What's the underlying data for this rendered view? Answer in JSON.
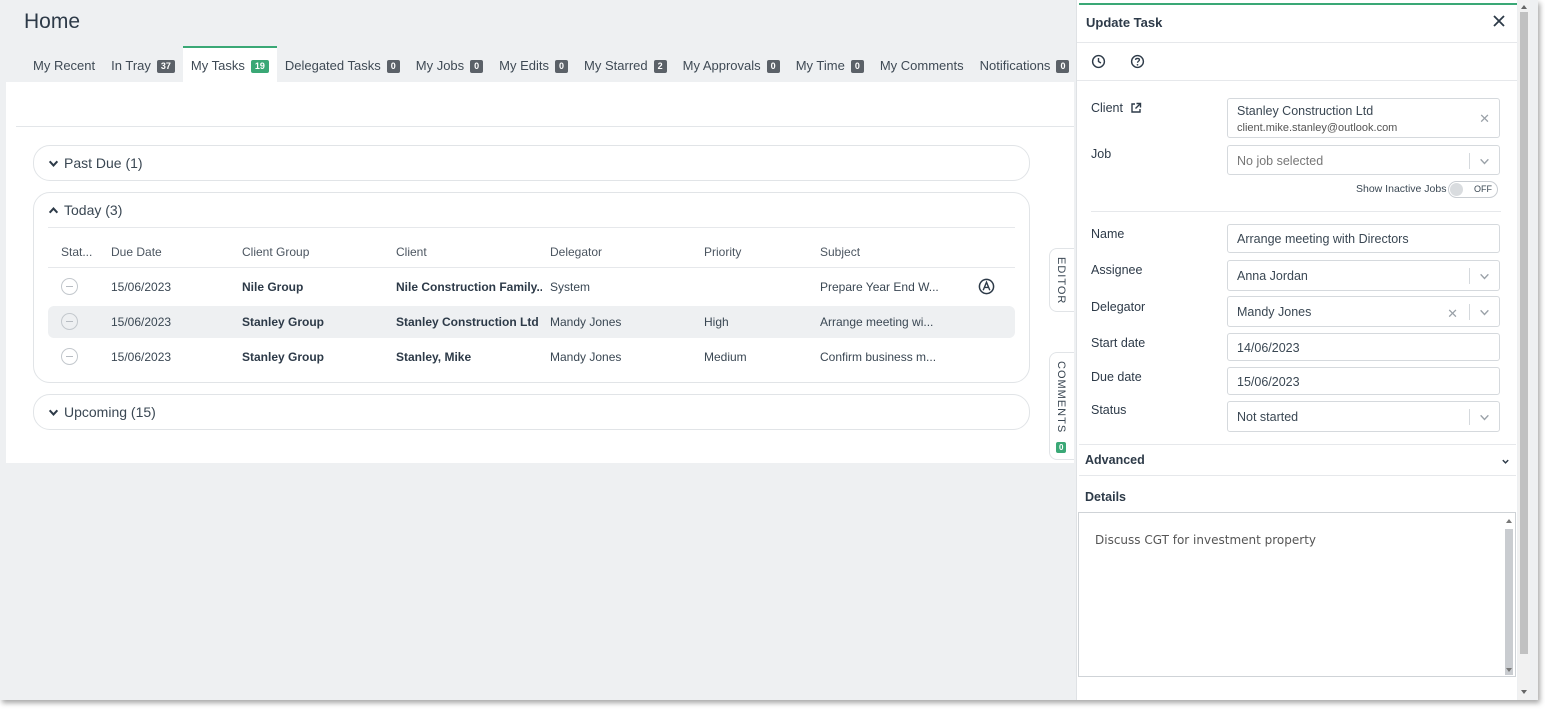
{
  "page": {
    "title": "Home"
  },
  "tabs": [
    {
      "label": "My Recent",
      "count": null
    },
    {
      "label": "In Tray",
      "count": "37"
    },
    {
      "label": "My Tasks",
      "count": "19",
      "active": true
    },
    {
      "label": "Delegated Tasks",
      "count": "0"
    },
    {
      "label": "My Jobs",
      "count": "0"
    },
    {
      "label": "My Edits",
      "count": "0"
    },
    {
      "label": "My Starred",
      "count": "2"
    },
    {
      "label": "My Approvals",
      "count": "0"
    },
    {
      "label": "My Time",
      "count": "0"
    },
    {
      "label": "My Comments",
      "count": null
    },
    {
      "label": "Notifications",
      "count": "0"
    }
  ],
  "sections": {
    "past_due": "Past Due (1)",
    "today": "Today (3)",
    "upcoming": "Upcoming (15)"
  },
  "table": {
    "headers": {
      "status": "Stat...",
      "due_date": "Due Date",
      "client_group": "Client Group",
      "client": "Client",
      "delegator": "Delegator",
      "priority": "Priority",
      "subject": "Subject"
    },
    "rows": [
      {
        "due_date": "15/06/2023",
        "client_group": "Nile Group",
        "client": "Nile Construction Family...",
        "delegator": "System",
        "priority": "",
        "subject": "Prepare Year End W..."
      },
      {
        "due_date": "15/06/2023",
        "client_group": "Stanley Group",
        "client": "Stanley Construction Ltd",
        "delegator": "Mandy Jones",
        "priority": "High",
        "subject": "Arrange meeting wi..."
      },
      {
        "due_date": "15/06/2023",
        "client_group": "Stanley Group",
        "client": "Stanley, Mike",
        "delegator": "Mandy Jones",
        "priority": "Medium",
        "subject": "Confirm business m..."
      }
    ]
  },
  "side_tabs": {
    "editor": "EDITOR",
    "comments": "COMMENTS",
    "comments_count": "0"
  },
  "panel": {
    "title": "Update Task",
    "labels": {
      "client": "Client",
      "job": "Job",
      "name": "Name",
      "assignee": "Assignee",
      "delegator": "Delegator",
      "start_date": "Start date",
      "due_date": "Due date",
      "status": "Status"
    },
    "client_name": "Stanley Construction Ltd",
    "client_email": "client.mike.stanley@outlook.com",
    "job_placeholder": "No job selected",
    "show_inactive_label": "Show Inactive Jobs",
    "toggle_state": "OFF",
    "name_value": "Arrange meeting with Directors",
    "assignee_value": "Anna Jordan",
    "delegator_value": "Mandy Jones",
    "start_date_value": "14/06/2023",
    "due_date_value": "15/06/2023",
    "status_value": "Not started",
    "advanced_label": "Advanced",
    "details_label": "Details",
    "details_text": "Discuss CGT for investment property"
  },
  "colors": {
    "accent": "#3aa876",
    "badge": "#5b6168"
  }
}
